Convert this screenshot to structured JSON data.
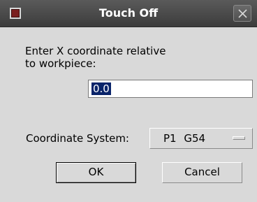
{
  "window": {
    "title": "Touch Off",
    "menu_icon": "window-menu-icon",
    "close_icon": "close-icon"
  },
  "prompt": {
    "text": "Enter X coordinate relative\nto workpiece:"
  },
  "coordinate_entry": {
    "value": "0.0",
    "selected": true
  },
  "coordinate_system": {
    "label": "Coordinate System:",
    "selected": "P1  G54"
  },
  "buttons": {
    "ok": "OK",
    "cancel": "Cancel"
  },
  "colors": {
    "titlebar": "#4a4a4a",
    "selection": "#0a246a",
    "dialog_bg": "#d9d9d9"
  }
}
